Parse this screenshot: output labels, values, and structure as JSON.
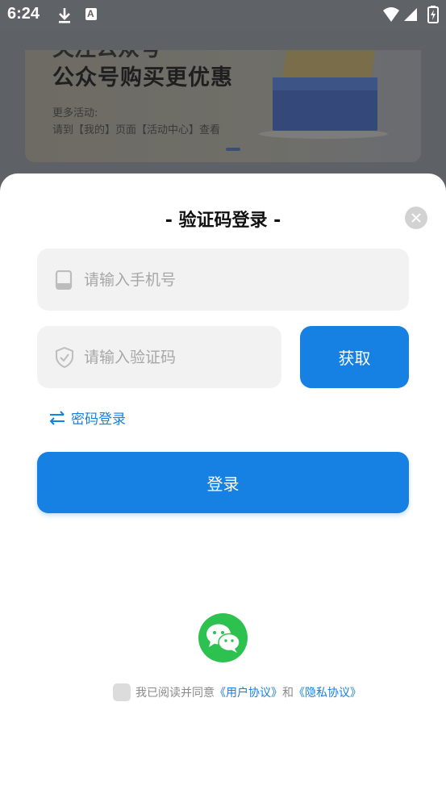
{
  "status_bar": {
    "time": "6:24",
    "download_icon": "download-icon",
    "app_icon": "a-icon",
    "app_icon_letter": "A"
  },
  "banner": {
    "top_text": "关注公众号",
    "headline": "公众号购买更优惠",
    "more_label": "更多活动:",
    "more_detail": "请到【我的】页面【活动中心】查看"
  },
  "login": {
    "title": "- 验证码登录 -",
    "phone_placeholder": "请输入手机号",
    "code_placeholder": "请输入验证码",
    "get_code_label": "获取",
    "switch_label": "密码登录",
    "login_label": "登录",
    "agree_prefix": "我已阅读并同意",
    "user_agreement": "《用户协议》",
    "and_text": "和",
    "privacy_policy": "《隐私协议》"
  },
  "colors": {
    "accent": "#1780e3",
    "wechat": "#2dc150",
    "field_bg": "#f2f2f2"
  }
}
